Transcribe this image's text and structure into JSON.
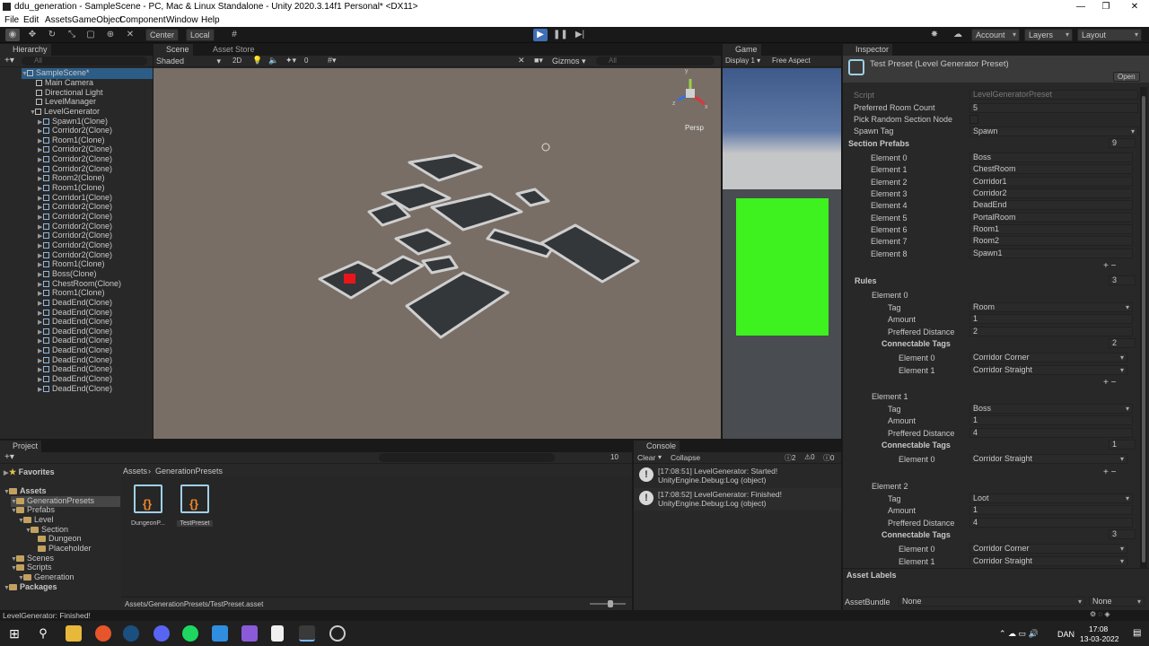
{
  "window": {
    "title": "ddu_generation - SampleScene - PC, Mac & Linux Standalone - Unity 2020.3.14f1 Personal* <DX11>",
    "minimize": "—",
    "maximize": "❐",
    "close": "✕"
  },
  "menu": [
    "File",
    "Edit",
    "Assets",
    "GameObject",
    "Component",
    "Window",
    "Help"
  ],
  "toolbar": {
    "pivot_center": "Center",
    "pivot_local": "Local",
    "account": "Account",
    "layers": "Layers",
    "layout": "Layout"
  },
  "hierarchy": {
    "tab": "Hierarchy",
    "search_placeholder": "All",
    "scene": "SampleScene*",
    "root_items": [
      "Main Camera",
      "Directional Light",
      "LevelManager",
      "LevelGenerator"
    ],
    "children": [
      "Spawn1(Clone)",
      "Corridor2(Clone)",
      "Room1(Clone)",
      "Corridor2(Clone)",
      "Corridor2(Clone)",
      "Corridor2(Clone)",
      "Room2(Clone)",
      "Room1(Clone)",
      "Corridor1(Clone)",
      "Corridor2(Clone)",
      "Corridor2(Clone)",
      "Corridor2(Clone)",
      "Corridor2(Clone)",
      "Corridor2(Clone)",
      "Corridor2(Clone)",
      "Room1(Clone)",
      "Boss(Clone)",
      "ChestRoom(Clone)",
      "Room1(Clone)",
      "DeadEnd(Clone)",
      "DeadEnd(Clone)",
      "DeadEnd(Clone)",
      "DeadEnd(Clone)",
      "DeadEnd(Clone)",
      "DeadEnd(Clone)",
      "DeadEnd(Clone)",
      "DeadEnd(Clone)",
      "DeadEnd(Clone)",
      "DeadEnd(Clone)"
    ]
  },
  "scene": {
    "tab": "Scene",
    "tab2": "Asset Store",
    "shading": "Shaded",
    "mode2d": "2D",
    "gizmos": "Gizmos",
    "search_placeholder": "All",
    "persp": "Persp",
    "fx_count": "0",
    "axis_y": "y",
    "axis_x": "x",
    "axis_z": "z"
  },
  "game": {
    "tab": "Game",
    "display": "Display 1",
    "aspect": "Free Aspect",
    "green_color": "#3df21f"
  },
  "inspector": {
    "tab": "Inspector",
    "title": "Test Preset (Level Generator Preset)",
    "open": "Open",
    "script_label": "Script",
    "script_value": "LevelGeneratorPreset",
    "fields": [
      {
        "label": "Preferred Room Count",
        "value": "5"
      },
      {
        "label": "Pick Random Section Node",
        "value": ""
      },
      {
        "label": "Spawn Tag",
        "value": "Spawn"
      }
    ],
    "section_prefabs": {
      "label": "Section Prefabs",
      "count": "9",
      "items": [
        {
          "label": "Element 0",
          "value": "Boss"
        },
        {
          "label": "Element 1",
          "value": "ChestRoom"
        },
        {
          "label": "Element 2",
          "value": "Corridor1"
        },
        {
          "label": "Element 3",
          "value": "Corridor2"
        },
        {
          "label": "Element 4",
          "value": "DeadEnd"
        },
        {
          "label": "Element 5",
          "value": "PortalRoom"
        },
        {
          "label": "Element 6",
          "value": "Room1"
        },
        {
          "label": "Element 7",
          "value": "Room2"
        },
        {
          "label": "Element 8",
          "value": "Spawn1"
        }
      ]
    },
    "rules": {
      "label": "Rules",
      "count": "3",
      "items": [
        {
          "label": "Element 0",
          "tag": "Room",
          "amount": "1",
          "distance": "2",
          "ct_count": "2",
          "ct": [
            "Corridor Corner",
            "Corridor Straight"
          ]
        },
        {
          "label": "Element 1",
          "tag": "Boss",
          "amount": "1",
          "distance": "4",
          "ct_count": "1",
          "ct": [
            "Corridor Straight"
          ]
        },
        {
          "label": "Element 2",
          "tag": "Loot",
          "amount": "1",
          "distance": "4",
          "ct_count": "3",
          "ct": [
            "Corridor Corner",
            "Corridor Straight"
          ]
        }
      ]
    },
    "labels": {
      "tag": "Tag",
      "amount": "Amount",
      "distance": "Preffered Distance",
      "ct": "Connectable Tags"
    },
    "asset_labels": "Asset Labels",
    "asset_bundle": "AssetBundle",
    "bundle_none": "None",
    "bundle_none2": "None"
  },
  "project": {
    "tab": "Project",
    "favorites": "Favorites",
    "tree": [
      {
        "label": "Assets",
        "depth": 0,
        "bold": true
      },
      {
        "label": "GenerationPresets",
        "depth": 1,
        "selected": true
      },
      {
        "label": "Prefabs",
        "depth": 1
      },
      {
        "label": "Level",
        "depth": 2
      },
      {
        "label": "Section",
        "depth": 3
      },
      {
        "label": "Dungeon",
        "depth": 4
      },
      {
        "label": "Placeholder",
        "depth": 4
      },
      {
        "label": "Scenes",
        "depth": 1
      },
      {
        "label": "Scripts",
        "depth": 1
      },
      {
        "label": "Generation",
        "depth": 2
      },
      {
        "label": "Packages",
        "depth": 0,
        "bold": true
      }
    ],
    "breadcrumb_root": "Assets",
    "breadcrumb_leaf": "GenerationPresets",
    "assets": [
      {
        "name": "DungeonP..."
      },
      {
        "name": "TestPreset"
      }
    ],
    "path": "Assets/GenerationPresets/TestPreset.asset",
    "hidden_count": "10"
  },
  "console": {
    "tab": "Console",
    "clear": "Clear",
    "collapse": "Collapse",
    "count_log": "2",
    "count_warn": "0",
    "count_err": "0",
    "logs": [
      {
        "line1": "[17:08:51] LevelGenerator: Started!",
        "line2": "UnityEngine.Debug:Log (object)"
      },
      {
        "line1": "[17:08:52] LevelGenerator: Finished!",
        "line2": "UnityEngine.Debug:Log (object)"
      }
    ]
  },
  "status": "LevelGenerator: Finished!",
  "taskbar": {
    "lang": "DAN",
    "time": "17:08",
    "date": "13-03-2022"
  }
}
